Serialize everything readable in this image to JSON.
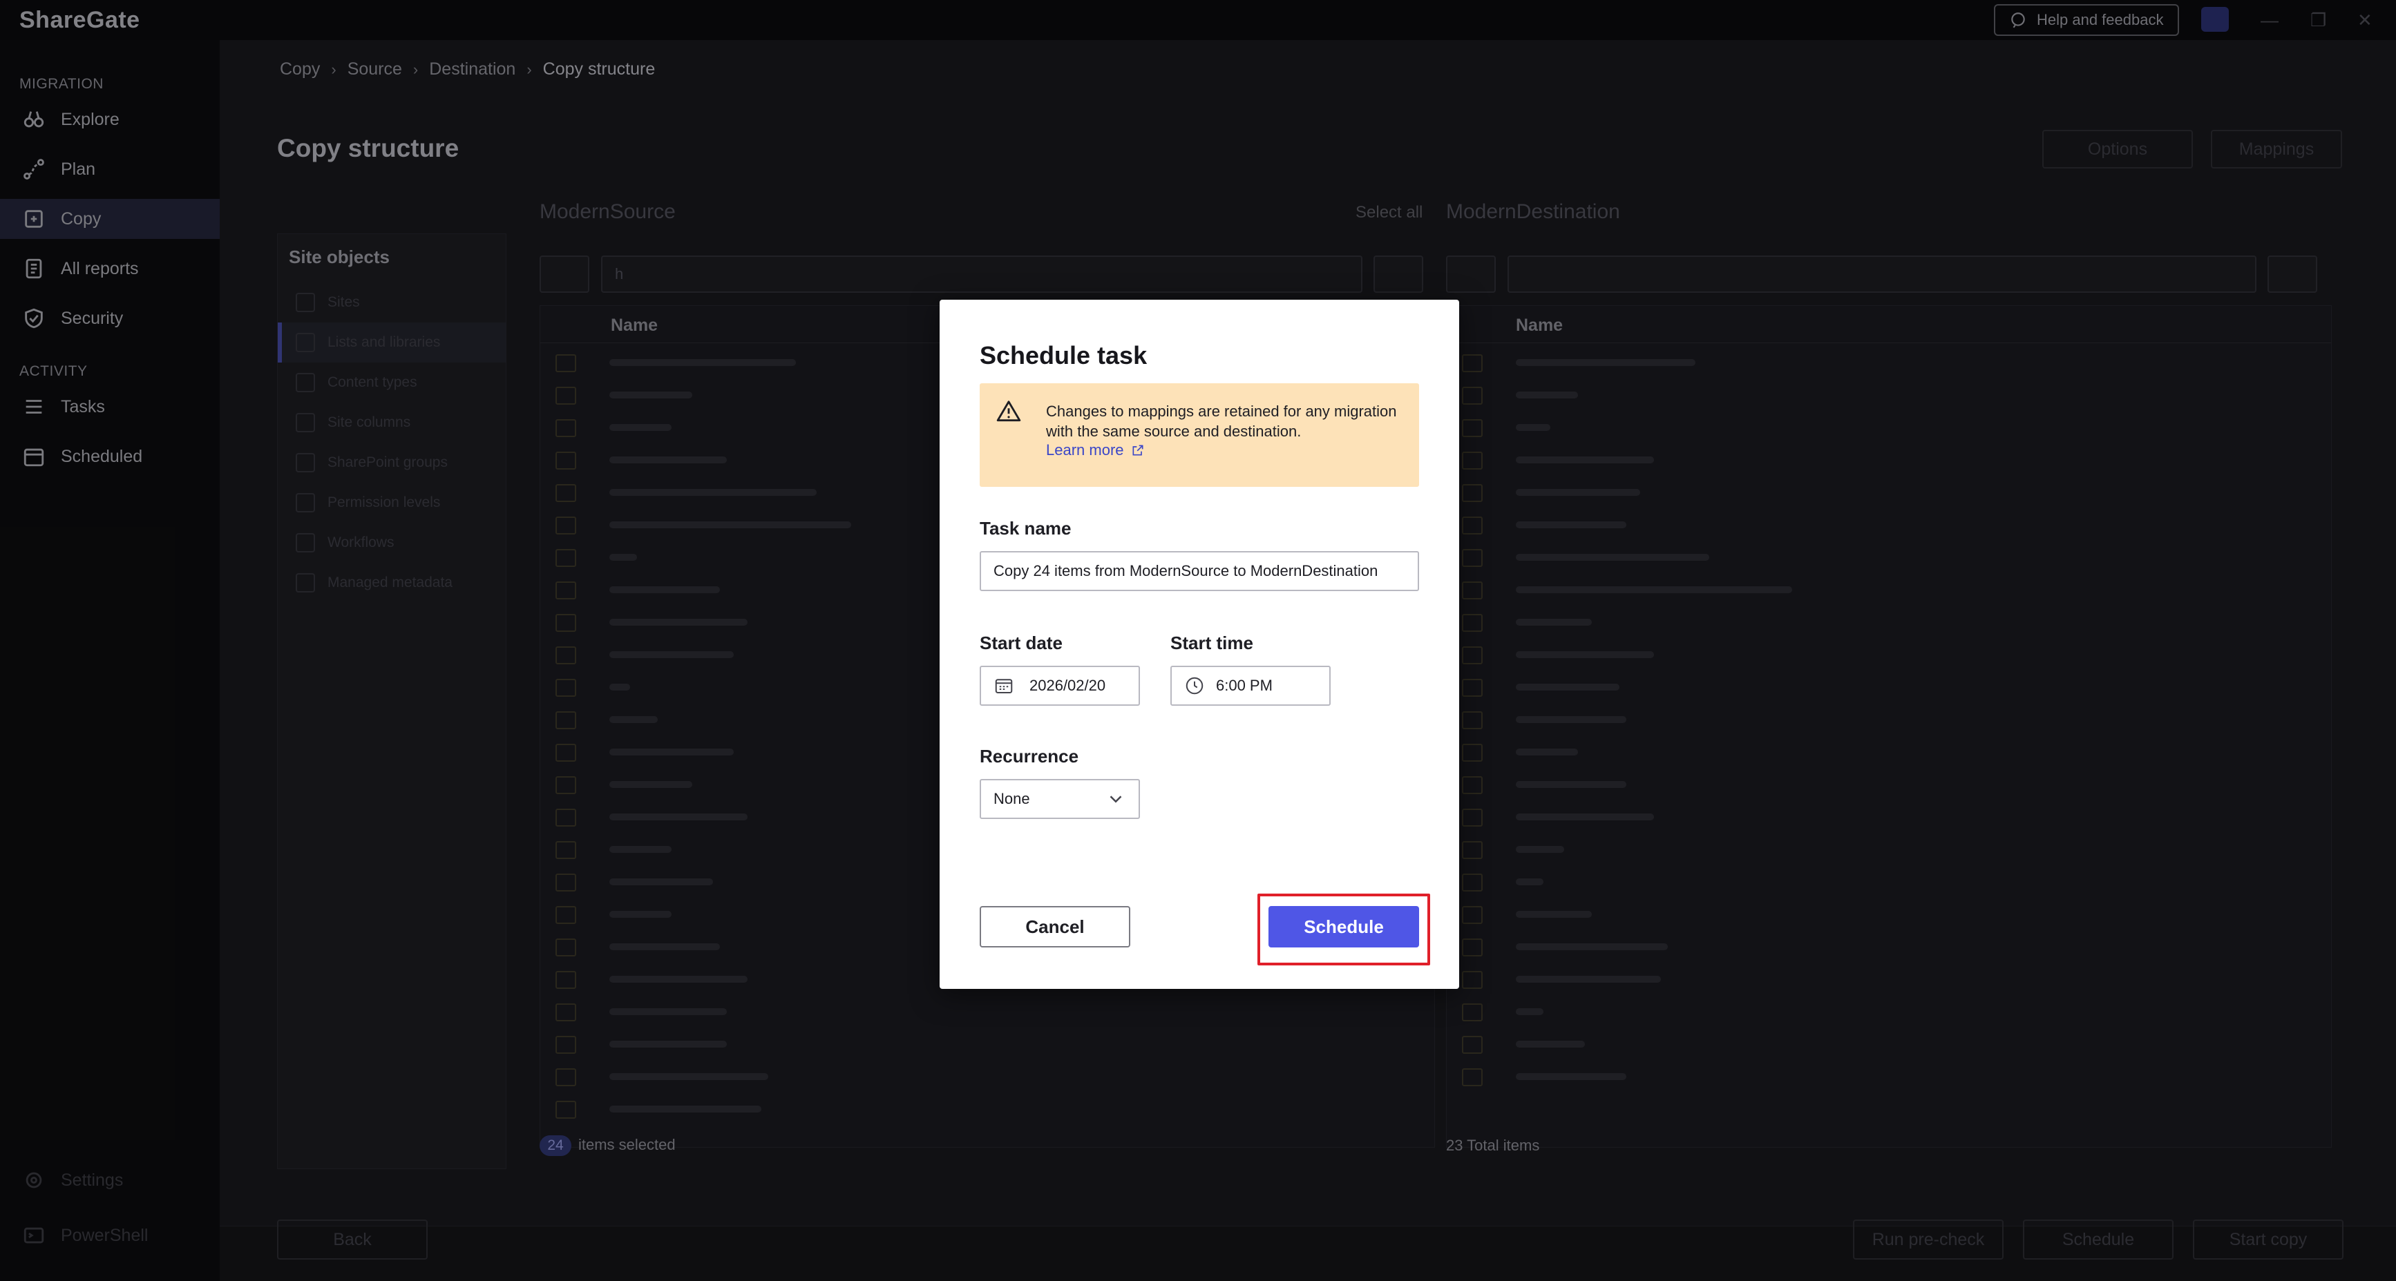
{
  "app": {
    "brand": "ShareGate",
    "help_label": "Help and feedback"
  },
  "sidebar": {
    "migration_section": "MIGRATION",
    "activity_section": "ACTIVITY",
    "items": [
      {
        "label": "Explore",
        "icon": "binoculars-icon"
      },
      {
        "label": "Plan",
        "icon": "plan-icon"
      },
      {
        "label": "Copy",
        "icon": "copy-icon"
      },
      {
        "label": "All reports",
        "icon": "reports-icon"
      },
      {
        "label": "Security",
        "icon": "shield-icon"
      },
      {
        "label": "Tasks",
        "icon": "tasks-icon"
      },
      {
        "label": "Scheduled",
        "icon": "calendar-icon"
      }
    ],
    "bottom_items": [
      {
        "label": "Settings",
        "icon": "gear-icon"
      },
      {
        "label": "PowerShell",
        "icon": "terminal-icon"
      }
    ]
  },
  "breadcrumb": [
    "Copy",
    "Source",
    "Destination",
    "Copy structure"
  ],
  "page": {
    "title": "Copy structure",
    "options_label": "Options",
    "mappings_label": "Mappings"
  },
  "site_objects": {
    "header": "Site objects",
    "items": [
      "Sites",
      "Lists and libraries",
      "Content types",
      "Site columns",
      "SharePoint groups",
      "Permission levels",
      "Workflows",
      "Managed metadata"
    ]
  },
  "source": {
    "title": "ModernSource",
    "select_all": "Select all",
    "column": "Name",
    "search_value": "h"
  },
  "destination": {
    "title": "ModernDestination",
    "column": "Name"
  },
  "status": {
    "selected_count": "24",
    "selected_label": "items selected",
    "total_label": "23 Total items"
  },
  "footer": {
    "back": "Back",
    "precheck": "Run pre-check",
    "schedule": "Schedule",
    "start": "Start copy"
  },
  "dialog": {
    "title": "Schedule task",
    "warning_text": "Changes to mappings are retained for any migration with the same source and destination.",
    "learn_more": "Learn more",
    "task_name_label": "Task name",
    "task_name_value": "Copy 24 items from ModernSource to ModernDestination",
    "start_date_label": "Start date",
    "start_date_value": "2026/02/20",
    "start_time_label": "Start time",
    "start_time_value": "6:00 PM",
    "recurrence_label": "Recurrence",
    "recurrence_value": "None",
    "cancel": "Cancel",
    "schedule": "Schedule"
  },
  "colors": {
    "accent": "#4f56e6",
    "warning_bg": "#fde2b8",
    "highlight": "#e0202a"
  }
}
